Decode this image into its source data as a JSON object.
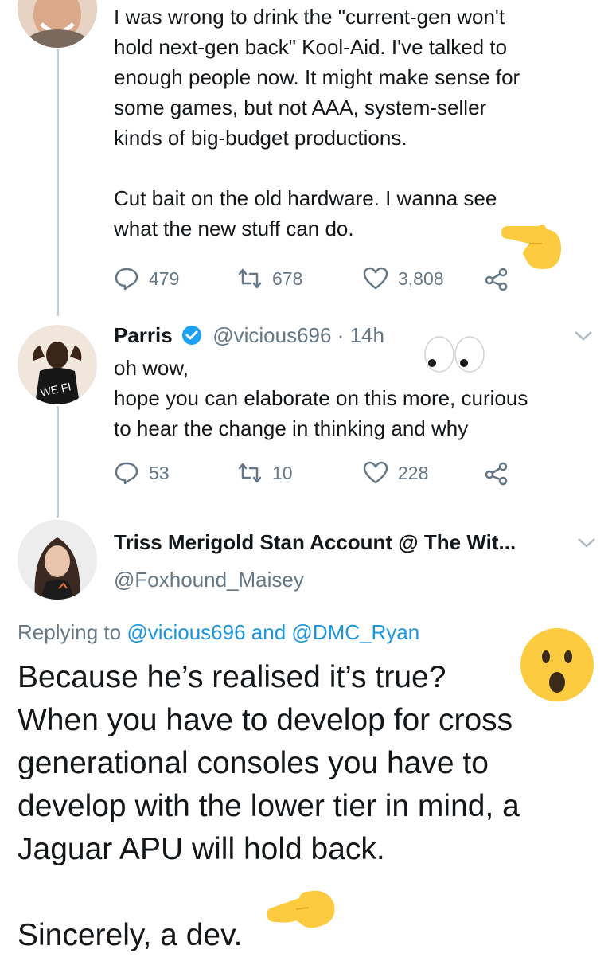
{
  "tweet1": {
    "text": "I was wrong to drink the \"current-gen won't\nhold next-gen back\" Kool-Aid. I've talked to\nenough people now. It might make sense for\nsome games, but not AAA, system-seller\nkinds of big-budget productions.\n\nCut bait on the old hardware. I wanna see\nwhat the new stuff can do.",
    "replies": "479",
    "retweets": "678",
    "likes": "3,808"
  },
  "tweet2": {
    "name": "Parris",
    "handle": "@vicious696",
    "time": "· 14h",
    "text": "oh wow,\nhope you can elaborate on this more, curious\nto hear the change in thinking and why",
    "replies": "53",
    "retweets": "10",
    "likes": "228"
  },
  "tweet3": {
    "name": "Triss Merigold Stan Account @ The Wit...",
    "handle": "@Foxhound_Maisey",
    "replying_prefix": "Replying to",
    "replying_user1": "@vicious696",
    "replying_and": "and",
    "replying_user2": "@DMC_Ryan",
    "text": "Because he’s realised it’s true?\nWhen you have to develop for cross\ngenerational consoles you have to\ndevelop with the lower tier in mind, a\nJaguar APU will hold back.\n\nSincerely, a dev."
  },
  "icons": {
    "reply": "reply-icon",
    "retweet": "retweet-icon",
    "like": "heart-icon",
    "share": "share-icon",
    "verified": "verified-badge-icon",
    "caret": "chevron-down-icon"
  },
  "colors": {
    "text": "#14171a",
    "secondary": "#657786",
    "link": "#1b95e0",
    "verified": "#1da1f2",
    "thread_line": "#c4cfd6",
    "emoji_yellow": "#fdcb3f"
  }
}
